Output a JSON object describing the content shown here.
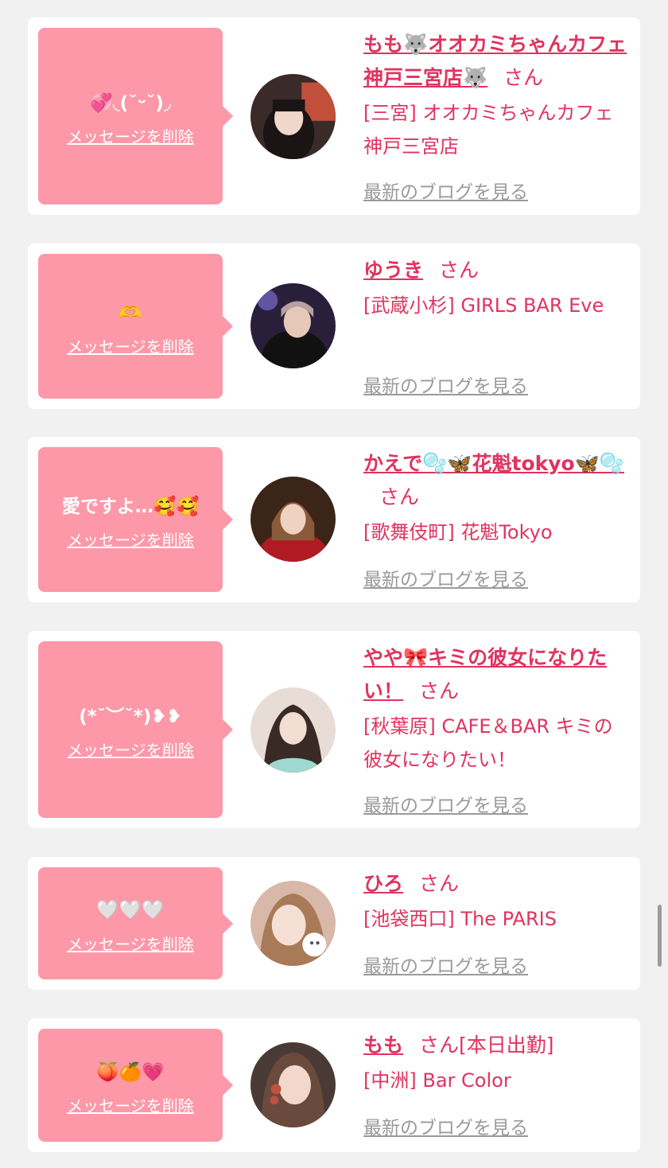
{
  "delete_label": "メッセージを削除",
  "blog_label": "最新のブログを見る",
  "san_label": "さん",
  "colors": {
    "accent": "#e0335f",
    "bubble": "#fd98a8",
    "background": "#f1f1f1",
    "link_gray": "#9a9a9a"
  },
  "entries": [
    {
      "message": "💞◟(˘ᵕ˘)◞",
      "name": "もも🐺オオカミちゃんカフェ神戸三宮店🐺",
      "san_suffix": "",
      "shop": "[三宮] オオカミちゃんカフェ神戸三宮店"
    },
    {
      "message": "🫶",
      "name": "ゆうき",
      "san_suffix": "",
      "shop": "[武蔵小杉] GIRLS BAR Eve"
    },
    {
      "message": "愛ですよ…🥰🥰",
      "name": "かえで🫧🦋花魁tokyo🦋🫧",
      "san_suffix": "",
      "shop": "[歌舞伎町] 花魁Tokyo"
    },
    {
      "message": "(*˘︶˘*)❥❥",
      "name": "やや🎀キミの彼女になりたい！",
      "san_suffix": "",
      "shop": "[秋葉原] CAFE＆BAR キミの彼女になりたい！"
    },
    {
      "message": "🤍🤍🤍",
      "name": "ひろ",
      "san_suffix": "",
      "shop": "[池袋西口] The PARIS"
    },
    {
      "message": "🍑🍊💗",
      "name": "もも",
      "san_suffix": "[本日出勤]",
      "shop": "[中洲] Bar Color"
    }
  ]
}
